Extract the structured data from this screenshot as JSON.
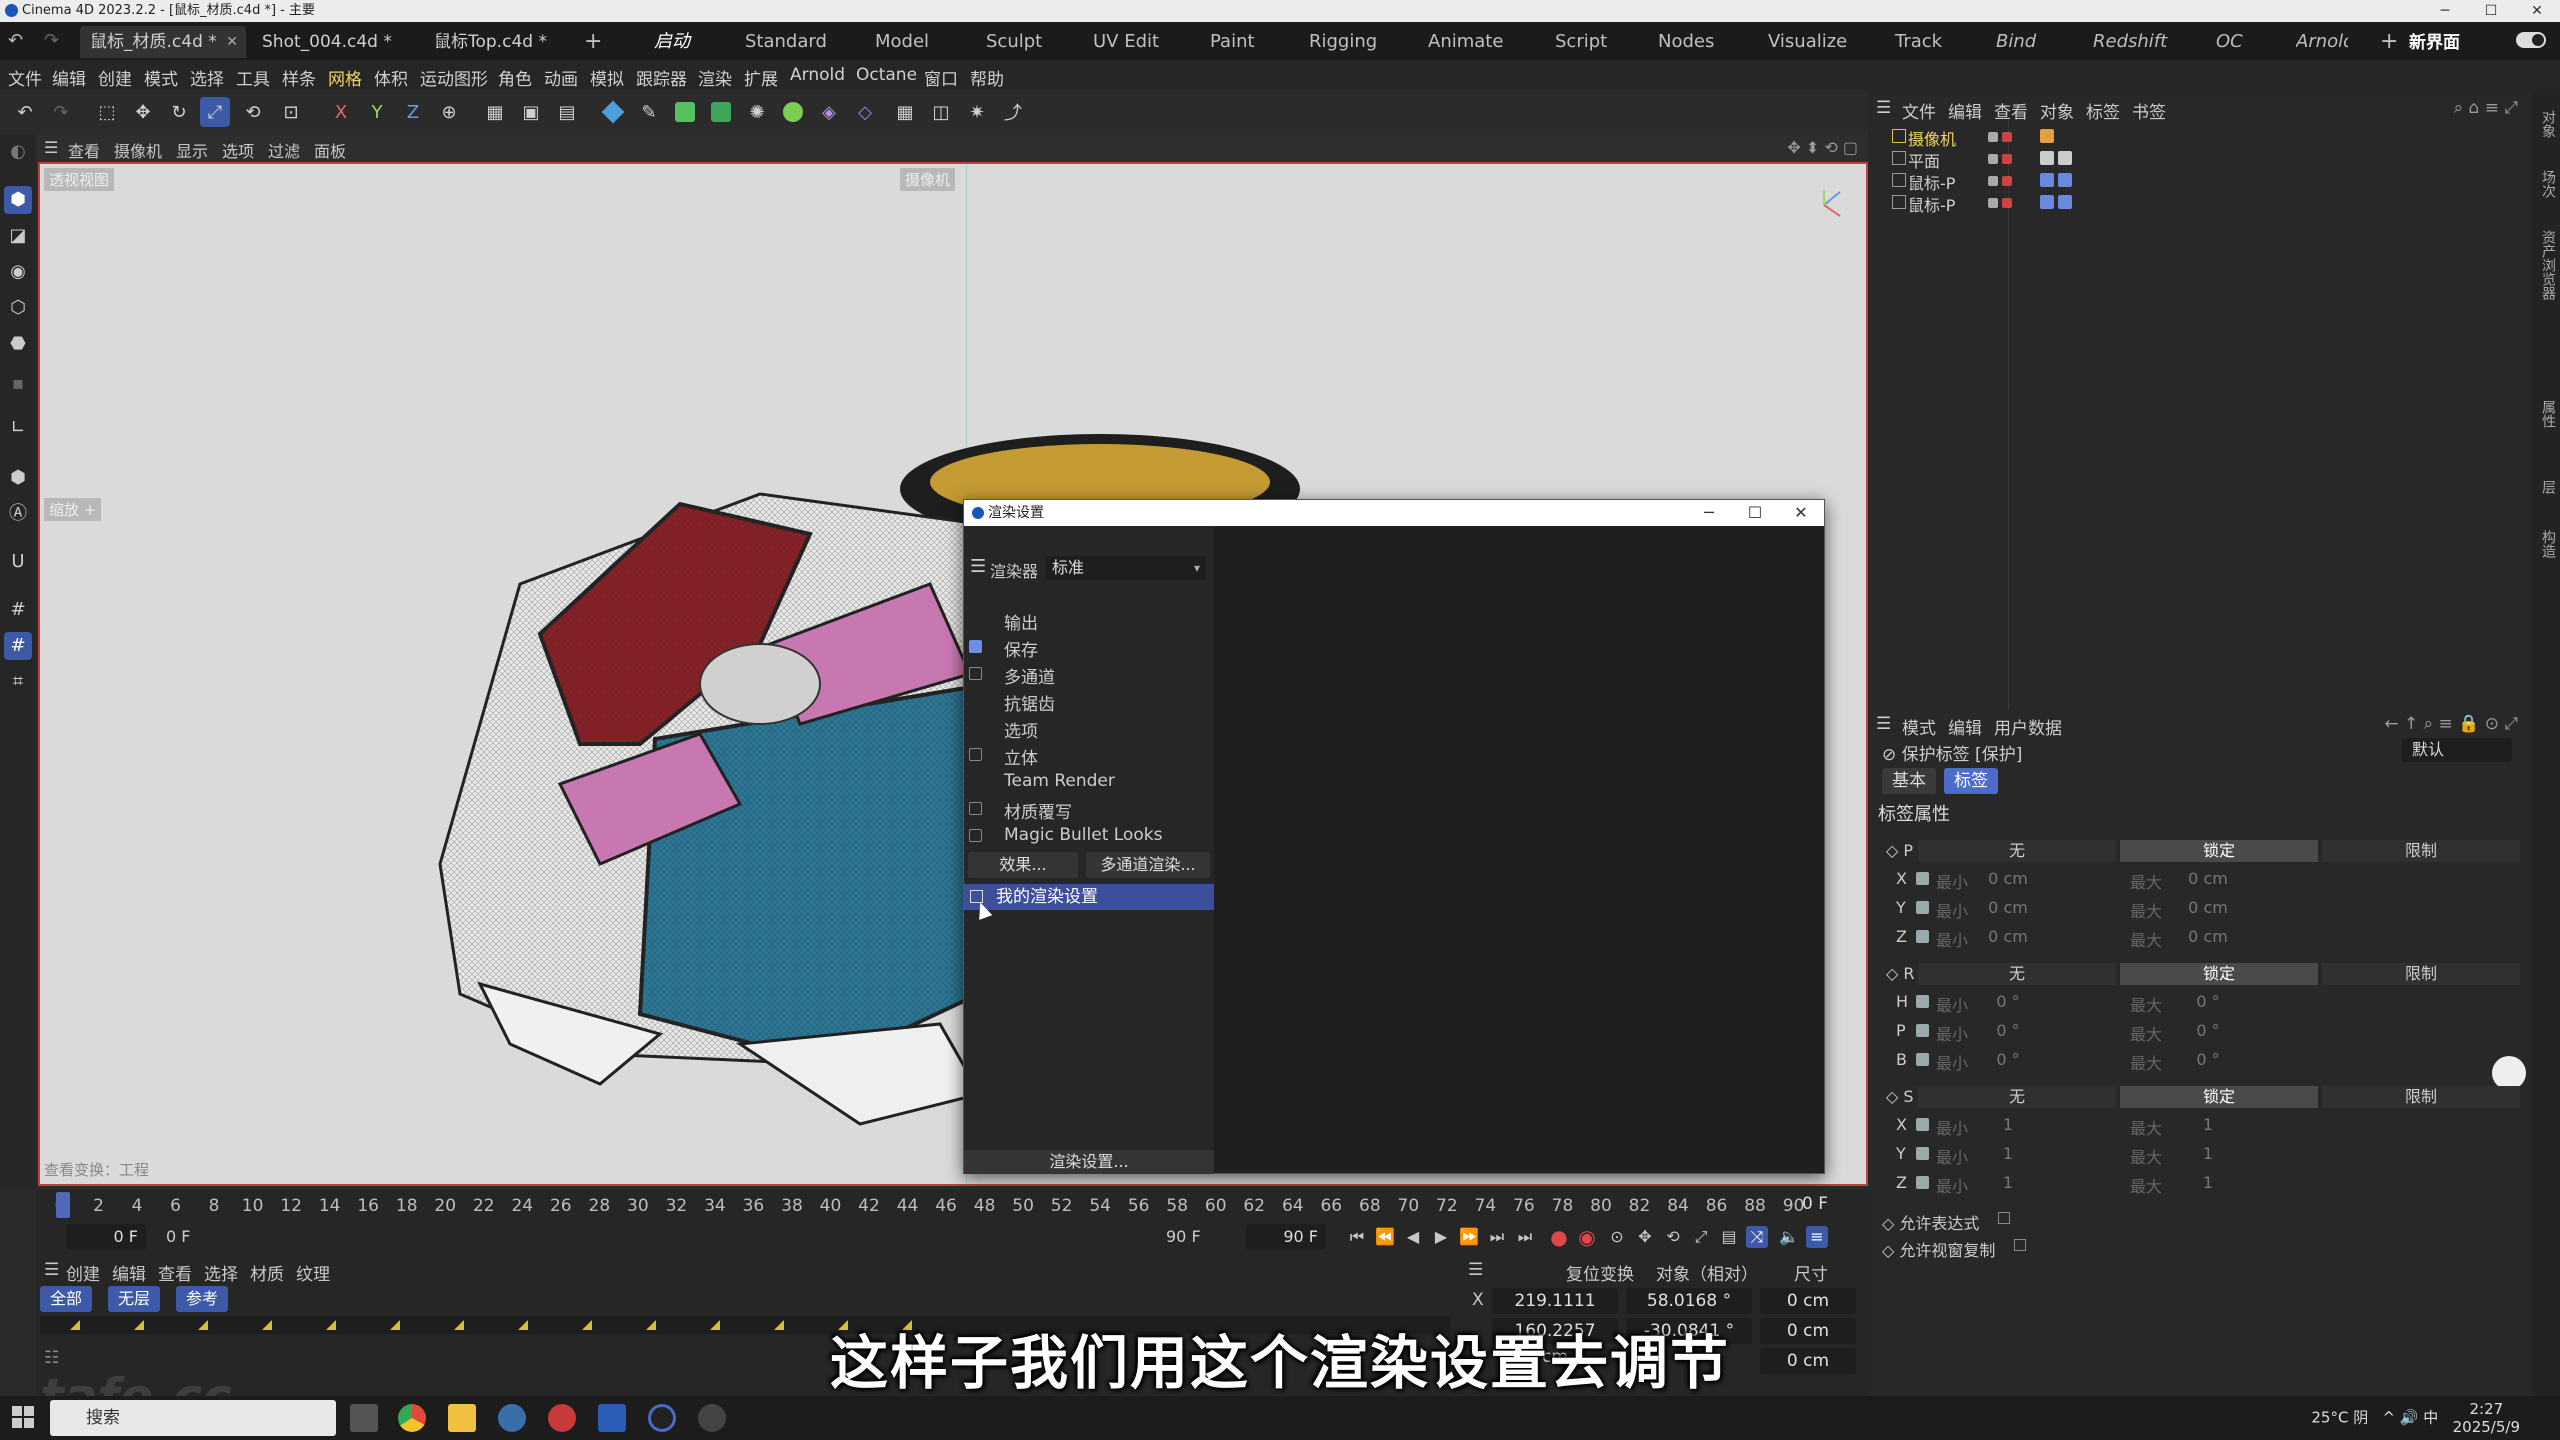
{
  "window": {
    "title": "Cinema 4D 2023.2.2 - [鼠标_材质.c4d *] - 主要"
  },
  "doc_tabs": [
    {
      "label": "鼠标_材质.c4d *",
      "active": true
    },
    {
      "label": "Shot_004.c4d *",
      "active": false
    },
    {
      "label": "鼠标Top.c4d *",
      "active": false
    }
  ],
  "add_tab": "+",
  "layouts": [
    "启动",
    "Standard",
    "Model",
    "Sculpt",
    "UV Edit",
    "Paint",
    "Rigging",
    "Animate",
    "Script",
    "Nodes",
    "Visualize",
    "Track",
    "Bind",
    "Redshift",
    "OC",
    "Arnold"
  ],
  "new_ui": "新界面",
  "menu": [
    "文件",
    "编辑",
    "创建",
    "模式",
    "选择",
    "工具",
    "样条",
    "网格",
    "体积",
    "运动图形",
    "角色",
    "动画",
    "模拟",
    "跟踪器",
    "渲染",
    "扩展",
    "Arnold",
    "Octane",
    "窗口",
    "帮助"
  ],
  "viewport_menu": [
    "查看",
    "摄像机",
    "显示",
    "选项",
    "过滤",
    "面板"
  ],
  "viewport": {
    "label": "透视视图",
    "camera": "摄像机",
    "zoom_badge": "缩放 +",
    "footer": "查看变换：工程"
  },
  "timeline": {
    "ticks": [
      "0",
      "2",
      "4",
      "6",
      "8",
      "10",
      "12",
      "14",
      "16",
      "18",
      "20",
      "22",
      "24",
      "26",
      "28",
      "30",
      "32",
      "34",
      "36",
      "38",
      "40",
      "42",
      "44",
      "46",
      "48",
      "50",
      "52",
      "54",
      "56",
      "58",
      "60",
      "62",
      "64",
      "66",
      "68",
      "70",
      "72",
      "74",
      "76",
      "78",
      "80",
      "82",
      "84",
      "86",
      "88",
      "90"
    ],
    "end_frame": "0 F",
    "start_a": "0 F",
    "start_b": "0 F",
    "end_a": "90 F",
    "end_b": "90 F"
  },
  "material_menu": [
    "创建",
    "编辑",
    "查看",
    "选择",
    "材质",
    "纹理"
  ],
  "material_filters": [
    "全部",
    "无层",
    "参考"
  ],
  "coords": {
    "reset": "复位变换",
    "mode": "对象（相对）",
    "size": "尺寸",
    "x_label": "X",
    "x_pos": "219.1111 cm",
    "x_rot": "58.0168 °",
    "x_size": "0 cm",
    "y_pos": "160.2257 cm",
    "y_rot": "-30.0841 °",
    "y_size": "0 cm",
    "z_size": "0 cm"
  },
  "subtitle": "这样子我们用这个渲染设置去调节",
  "watermark": "tafe.cc",
  "taskbar": {
    "search": "搜索",
    "weather": "25°C 阴",
    "ime": "中",
    "time": "2:27",
    "date": "2025/5/9"
  },
  "objects": {
    "menu": [
      "文件",
      "编辑",
      "查看",
      "对象",
      "标签",
      "书签"
    ],
    "items": [
      {
        "name": "摄像机",
        "highlight": true
      },
      {
        "name": "平面",
        "highlight": false
      },
      {
        "name": "鼠标-P",
        "highlight": false
      },
      {
        "name": "鼠标-P",
        "highlight": false
      }
    ]
  },
  "attributes": {
    "menu": [
      "模式",
      "编辑",
      "用户数据"
    ],
    "title": "保护标签 [保护]",
    "preset": "默认",
    "tabs": [
      "基本",
      "标签"
    ],
    "section": "标签属性",
    "groups": [
      {
        "label": "P",
        "opts": [
          "无",
          "锁定",
          "限制"
        ],
        "rows": [
          {
            "axis": "X",
            "min": "0 cm",
            "max": "0 cm"
          },
          {
            "axis": "Y",
            "min": "0 cm",
            "max": "0 cm"
          },
          {
            "axis": "Z",
            "min": "0 cm",
            "max": "0 cm"
          }
        ]
      },
      {
        "label": "R",
        "opts": [
          "无",
          "锁定",
          "限制"
        ],
        "rows": [
          {
            "axis": "H",
            "min": "0 °",
            "max": "0 °"
          },
          {
            "axis": "P",
            "min": "0 °",
            "max": "0 °"
          },
          {
            "axis": "B",
            "min": "0 °",
            "max": "0 °"
          }
        ]
      },
      {
        "label": "S",
        "opts": [
          "无",
          "锁定",
          "限制"
        ],
        "rows": [
          {
            "axis": "X",
            "min": "1",
            "max": "1"
          },
          {
            "axis": "Y",
            "min": "1",
            "max": "1"
          },
          {
            "axis": "Z",
            "min": "1",
            "max": "1"
          }
        ]
      }
    ],
    "min_label": "最小",
    "max_label": "最大",
    "allow_expr": "允许表达式",
    "allow_copy": "允许视窗复制"
  },
  "right_strip": [
    "对象",
    "场次",
    "资产浏览器",
    "属性",
    "层",
    "构造"
  ],
  "render_dialog": {
    "title": "渲染设置",
    "renderer_label": "渲染器",
    "renderer": "标准",
    "sections": [
      {
        "label": "输出",
        "check": "none"
      },
      {
        "label": "保存",
        "check": "on"
      },
      {
        "label": "多通道",
        "check": "off"
      },
      {
        "label": "抗锯齿",
        "check": "none"
      },
      {
        "label": "选项",
        "check": "none"
      },
      {
        "label": "立体",
        "check": "off"
      },
      {
        "label": "Team Render",
        "check": "none"
      },
      {
        "label": "材质覆写",
        "check": "off"
      },
      {
        "label": "Magic Bullet Looks",
        "check": "off"
      }
    ],
    "effects_btn": "效果...",
    "multipass_btn": "多通道渲染...",
    "my_setting": "我的渲染设置",
    "render_setting_btn": "渲染设置..."
  }
}
